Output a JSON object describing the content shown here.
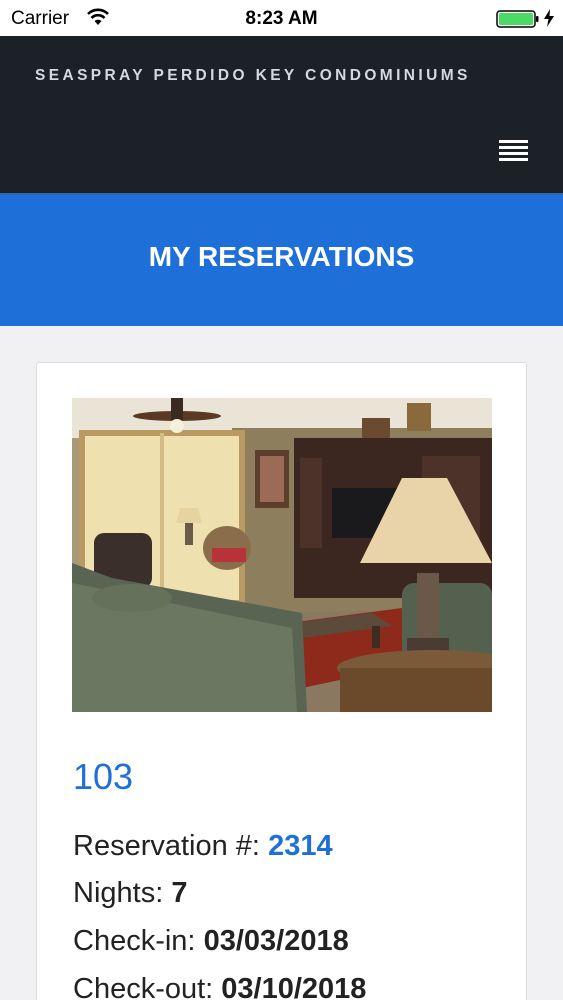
{
  "status_bar": {
    "carrier": "Carrier",
    "time": "8:23 AM",
    "battery_color": "#4cd964"
  },
  "header": {
    "site_title": "SEASPRAY PERDIDO KEY CONDOMINIUMS",
    "menu_icon": "hamburger-menu-icon"
  },
  "banner": {
    "title": "MY RESERVATIONS",
    "color": "#1e6fd8"
  },
  "reservation": {
    "unit": "103",
    "reservation_label": "Reservation #:",
    "reservation_number": "2314",
    "nights_label": "Nights:",
    "nights": "7",
    "checkin_label": "Check-in:",
    "checkin": "03/03/2018",
    "checkout_label": "Check-out:",
    "checkout": "03/10/2018"
  }
}
